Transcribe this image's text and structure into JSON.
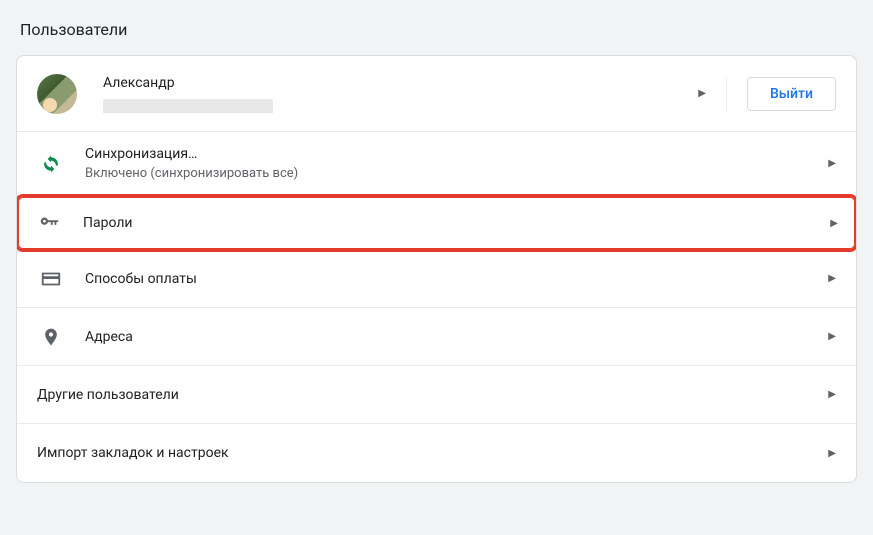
{
  "page": {
    "title": "Пользователи"
  },
  "user": {
    "name": "Александр",
    "signout_label": "Выйти"
  },
  "rows": {
    "sync": {
      "title": "Синхронизация…",
      "subtitle": "Включено (синхронизировать все)"
    },
    "passwords": {
      "title": "Пароли"
    },
    "payments": {
      "title": "Способы оплаты"
    },
    "addresses": {
      "title": "Адреса"
    },
    "other_users": {
      "title": "Другие пользователи"
    },
    "import": {
      "title": "Импорт закладок и настроек"
    }
  }
}
